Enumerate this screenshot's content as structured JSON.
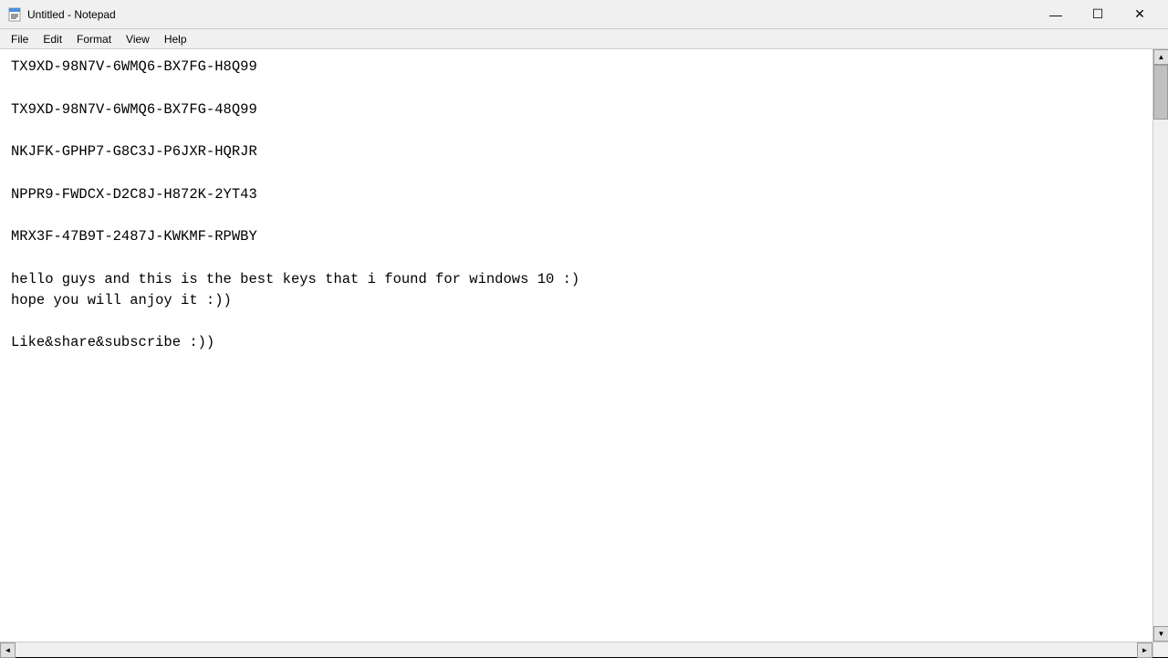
{
  "window": {
    "title": "Untitled - Notepad",
    "icon": "notepad-icon"
  },
  "titlebar": {
    "minimize_label": "—",
    "maximize_label": "☐",
    "close_label": "✕"
  },
  "menubar": {
    "items": [
      {
        "id": "file",
        "label": "File"
      },
      {
        "id": "edit",
        "label": "Edit"
      },
      {
        "id": "format",
        "label": "Format"
      },
      {
        "id": "view",
        "label": "View"
      },
      {
        "id": "help",
        "label": "Help"
      }
    ]
  },
  "editor": {
    "content": "TX9XD-98N7V-6WMQ6-BX7FG-H8Q99\n\nTX9XD-98N7V-6WMQ6-BX7FG-48Q99\n\nNKJFK-GPHP7-G8C3J-P6JXR-HQRJR\n\nNPPR9-FWDCX-D2C8J-H872K-2YT43\n\nMRX3F-47B9T-2487J-KWKMF-RPWBY\n\nhello guys and this is the best keys that i found for windows 10 :)\nhope you will anjoy it :))\n\nLike&share&subscribe :))"
  }
}
